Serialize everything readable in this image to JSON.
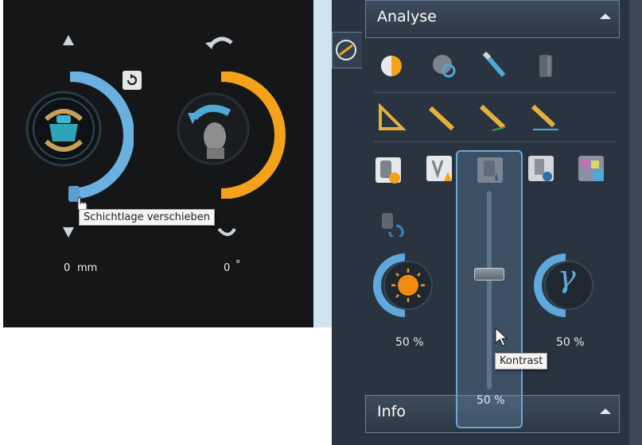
{
  "left_panel": {
    "layer_tooltip": "Schichtlage verschieben",
    "position_value": "0",
    "position_unit": "mm",
    "rotation_value": "0",
    "rotation_unit": "°",
    "colors": {
      "slice_ring": "#6ab0e0",
      "rotation_ring": "#f5a21b"
    }
  },
  "right_panel": {
    "analyse_header": "Analyse",
    "info_header": "Info",
    "brightness_value": "50 %",
    "contrast_value": "50 %",
    "gamma_value": "50 %",
    "gamma_symbol": "γ",
    "contrast_tooltip": "Kontrast",
    "contrast_level_percent": 50
  }
}
